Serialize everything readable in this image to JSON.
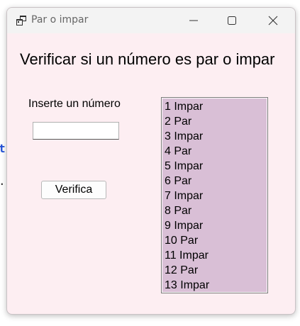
{
  "background": {
    "code_fragment": "t",
    "punct_fragment": "."
  },
  "window": {
    "title": "Par o impar",
    "icons": {
      "app": "app-window-icon",
      "minimize": "minimize-icon",
      "maximize": "maximize-icon",
      "close": "close-icon"
    },
    "colors": {
      "client_background": "#fdeef2",
      "listbox_background": "#d9bfd6"
    }
  },
  "form": {
    "heading": "Verificar si un número es par o impar",
    "prompt_label": "Inserte un número",
    "number_input": {
      "value": "",
      "placeholder": ""
    },
    "verify_button": "Verifica"
  },
  "results": [
    "1 Impar",
    "2 Par",
    "3 Impar",
    "4 Par",
    "5 Impar",
    "6 Par",
    "7 Impar",
    "8 Par",
    "9 Impar",
    "10 Par",
    "11 Impar",
    "12 Par",
    "13 Impar"
  ]
}
